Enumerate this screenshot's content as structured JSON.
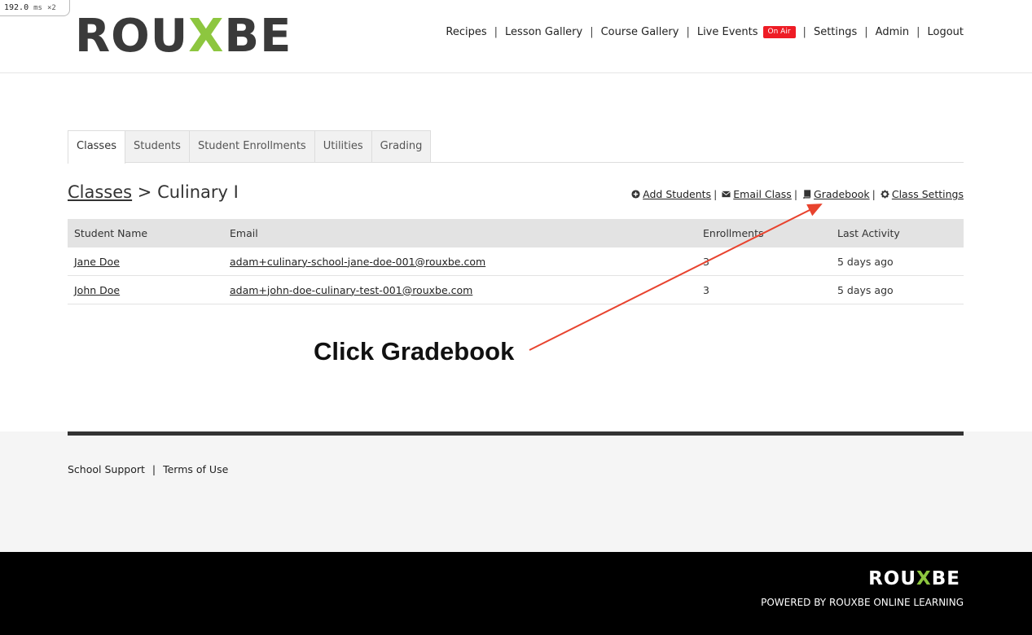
{
  "timer": {
    "value": "192.0",
    "unit": "ms",
    "mult": "×2"
  },
  "brand": {
    "pre": "ROU",
    "x": "X",
    "post": "BE",
    "accent": "#8dc63f"
  },
  "nav": {
    "items": [
      "Recipes",
      "Lesson Gallery",
      "Course Gallery",
      "Live Events",
      "Settings",
      "Admin",
      "Logout"
    ],
    "badge": "On Air",
    "badge_color": "#ee1c25"
  },
  "tabs": [
    "Classes",
    "Students",
    "Student Enrollments",
    "Utilities",
    "Grading"
  ],
  "breadcrumb": {
    "link": "Classes",
    "sep": " > ",
    "current": "Culinary I"
  },
  "actions": {
    "add_students": "Add Students",
    "email_class": "Email Class",
    "gradebook": "Gradebook",
    "class_settings": "Class Settings",
    "icons": [
      "plus-circle-icon",
      "envelope-icon",
      "book-icon",
      "gear-icon"
    ]
  },
  "table": {
    "headers": [
      "Student Name",
      "Email",
      "Enrollments",
      "Last Activity"
    ],
    "rows": [
      {
        "name": "Jane Doe",
        "email": "adam+culinary-school-jane-doe-001@rouxbe.com",
        "enrollments": "3",
        "last": "5 days ago"
      },
      {
        "name": "John Doe",
        "email": "adam+john-doe-culinary-test-001@rouxbe.com",
        "enrollments": "3",
        "last": "5 days ago"
      }
    ]
  },
  "annotation": {
    "text": "Click Gradebook",
    "arrow_color": "#e8432e"
  },
  "footer": {
    "links": [
      "School Support",
      "Terms of Use"
    ]
  },
  "bottom": {
    "powered": "POWERED BY ROUXBE ONLINE LEARNING"
  }
}
